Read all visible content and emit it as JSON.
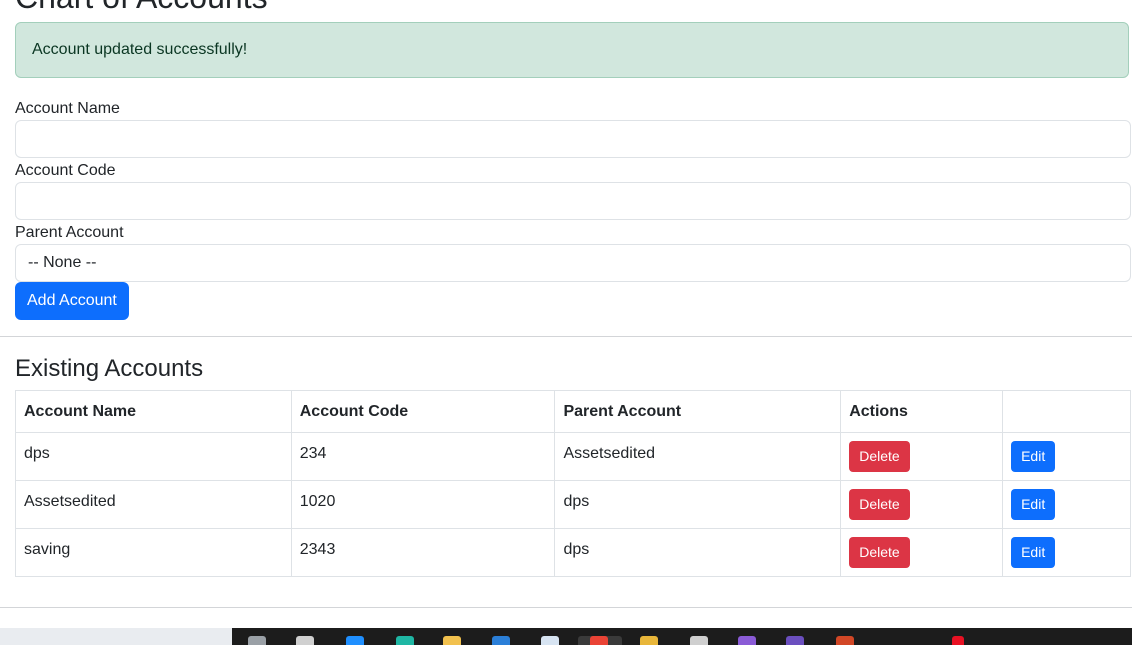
{
  "page": {
    "title": "Chart of Accounts"
  },
  "alert": {
    "message": "Account updated successfully!"
  },
  "form": {
    "account_name_label": "Account Name",
    "account_name_value": "",
    "account_code_label": "Account Code",
    "account_code_value": "",
    "parent_account_label": "Parent Account",
    "parent_account_selected": "-- None --",
    "submit_label": "Add Account"
  },
  "existing": {
    "heading": "Existing Accounts",
    "columns": [
      "Account Name",
      "Account Code",
      "Parent Account",
      "Actions",
      ""
    ],
    "rows": [
      {
        "name": "dps",
        "code": "234",
        "parent": "Assetsedited",
        "delete_label": "Delete",
        "edit_label": "Edit"
      },
      {
        "name": "Assetsedited",
        "code": "1020",
        "parent": "dps",
        "delete_label": "Delete",
        "edit_label": "Edit"
      },
      {
        "name": "saving",
        "code": "2343",
        "parent": "dps",
        "delete_label": "Delete",
        "edit_label": "Edit"
      }
    ]
  },
  "colors": {
    "primary": "#0d6efd",
    "danger": "#dc3545",
    "success_bg": "#d1e7dd",
    "success_text": "#0a3622"
  },
  "taskbar": {
    "icons": [
      "search-icon",
      "task-view-icon",
      "azure-icon",
      "edge-icon",
      "file-explorer-icon",
      "store-icon",
      "app-icon",
      "chrome-icon",
      "sql-icon",
      "notepad-icon",
      "visual-studio-icon",
      "app-icon",
      "powerpoint-icon",
      "notification-badge-icon"
    ]
  }
}
